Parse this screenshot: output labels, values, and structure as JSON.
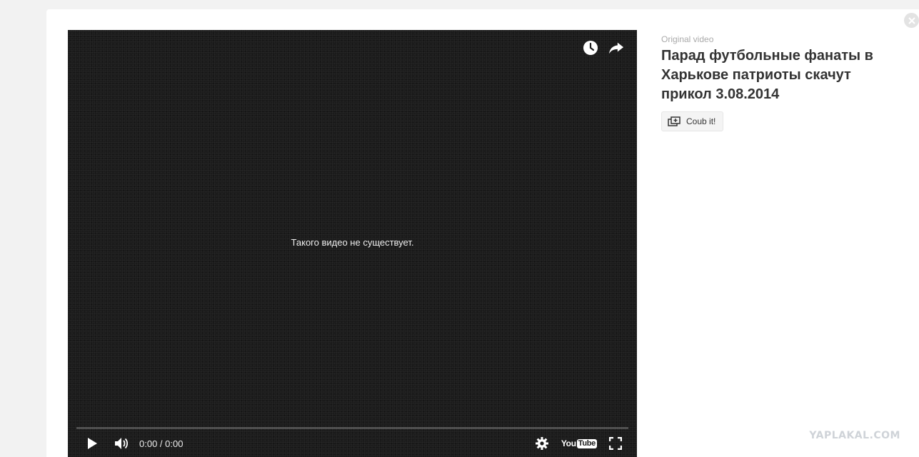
{
  "player": {
    "message": "Такого видео не существует.",
    "time": "0:00 / 0:00",
    "logo_text": "You",
    "logo_tube": "Tube",
    "progress": 0
  },
  "side": {
    "label": "Original video",
    "title": "Парад футбольные фанаты в Харькове патриоты скачут прикол 3.08.2014",
    "coub_button": "Coub it!"
  },
  "watermark": "YAPLAKAL.COM",
  "colors": {
    "player_bg": "#1b1b1b",
    "page_bg": "#f2f2f2",
    "card_bg": "#ffffff",
    "title": "#333333"
  },
  "icons": [
    "clock-icon",
    "share-icon",
    "play-icon",
    "volume-icon",
    "gear-icon",
    "fullscreen-icon",
    "close-icon",
    "coub-icon"
  ]
}
